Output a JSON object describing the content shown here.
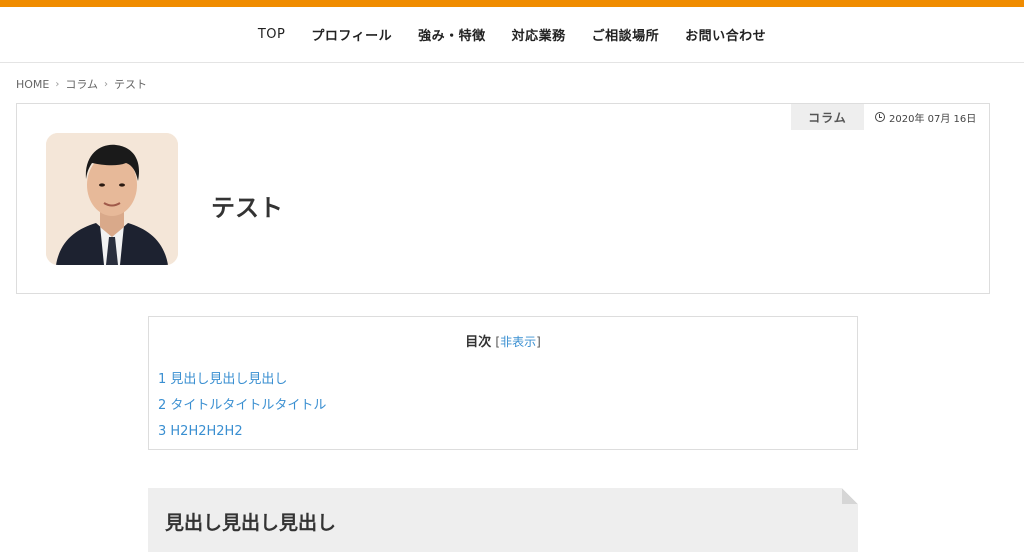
{
  "accent_color": "#f08c00",
  "link_color": "#3a8fd1",
  "nav": {
    "items": [
      "TOP",
      "プロフィール",
      "強み・特徴",
      "対応業務",
      "ご相談場所",
      "お問い合わせ"
    ]
  },
  "breadcrumb": {
    "home": "HOME",
    "category": "コラム",
    "current": "テスト"
  },
  "article": {
    "category": "コラム",
    "date": "2020年 07月 16日",
    "date_icon": "clock-icon",
    "title": "テスト",
    "thumbnail": "portrait-photo"
  },
  "toc": {
    "title": "目次",
    "toggle_open": "[",
    "toggle_label": "非表示",
    "toggle_close": "]",
    "items": [
      "1 見出し見出し見出し",
      "2 タイトルタイトルタイトル",
      "3 H2H2H2H2"
    ]
  },
  "section": {
    "heading": "見出し見出し見出し"
  }
}
